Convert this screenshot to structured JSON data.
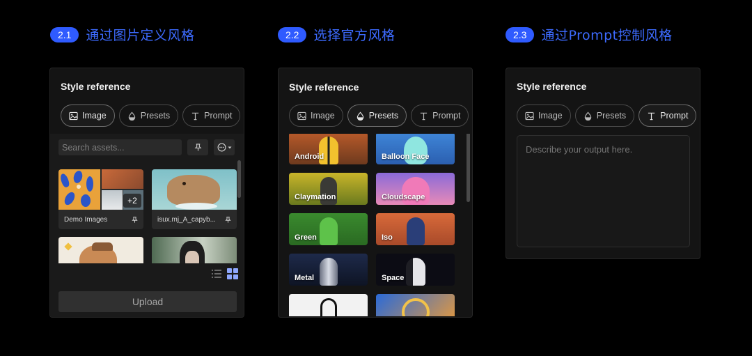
{
  "sections": [
    {
      "badge": "2.1",
      "title": "通过图片定义风格"
    },
    {
      "badge": "2.2",
      "title": "选择官方风格"
    },
    {
      "badge": "2.3",
      "title": "通过Prompt控制风格"
    }
  ],
  "panel": {
    "heading": "Style reference",
    "tabs": [
      "Image",
      "Presets",
      "Prompt"
    ]
  },
  "image_panel": {
    "search_placeholder": "Search assets...",
    "cards": [
      {
        "caption": "Demo Images",
        "badge": "+2"
      },
      {
        "caption": "isux.mj_A_capyb..."
      }
    ],
    "upload_label": "Upload"
  },
  "presets": [
    "Android",
    "Balloon Face",
    "Claymation",
    "Cloudscape",
    "Green",
    "Iso",
    "Metal",
    "Space"
  ],
  "prompt_panel": {
    "placeholder": "Describe your output here."
  },
  "colors": {
    "accent": "#2f5bff",
    "title": "#3d6bff",
    "panel_bg": "#141414",
    "page_bg": "#000000"
  },
  "icons": {
    "image_tab": "image-icon",
    "presets_tab": "drop-icon",
    "prompt_tab": "text-t-icon",
    "pin": "pin-icon",
    "more": "more-circle-icon",
    "list_view": "list-icon",
    "grid_view": "grid-icon"
  }
}
